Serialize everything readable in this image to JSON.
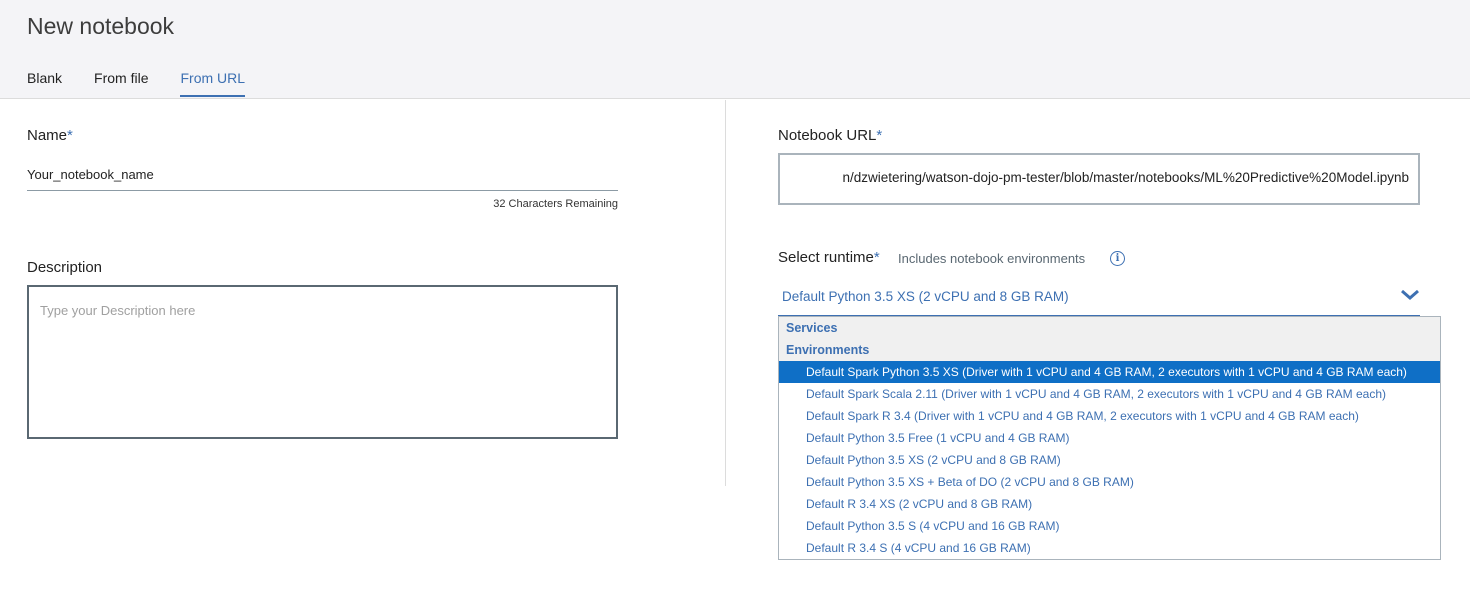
{
  "header": {
    "title": "New notebook",
    "tabs": [
      "Blank",
      "From file",
      "From URL"
    ],
    "active_tab": "From URL"
  },
  "form": {
    "name_label": "Name",
    "required_mark": "*",
    "name_value": "Your_notebook_name",
    "chars_remaining": "32 Characters Remaining",
    "description_label": "Description",
    "description_placeholder": "Type your Description here",
    "url_label": "Notebook URL",
    "url_value": "n/dzwietering/watson-dojo-pm-tester/blob/master/notebooks/ML%20Predictive%20Model.ipynb",
    "runtime_label": "Select runtime",
    "runtime_note": "Includes notebook environments",
    "runtime_selected": "Default Python 3.5 XS (2 vCPU and 8 GB RAM)"
  },
  "dropdown": {
    "groups": [
      "Services",
      "Environments"
    ],
    "options": [
      "Default Spark Python 3.5 XS (Driver with 1 vCPU and 4 GB RAM, 2 executors with 1 vCPU and 4 GB RAM each)",
      "Default Spark Scala 2.11 (Driver with 1 vCPU and 4 GB RAM, 2 executors with 1 vCPU and 4 GB RAM each)",
      "Default Spark R 3.4 (Driver with 1 vCPU and 4 GB RAM, 2 executors with 1 vCPU and 4 GB RAM each)",
      "Default Python 3.5 Free (1 vCPU and 4 GB RAM)",
      "Default Python 3.5 XS (2 vCPU and 8 GB RAM)",
      "Default Python 3.5 XS + Beta of DO (2 vCPU and 8 GB RAM)",
      "Default R 3.4 XS (2 vCPU and 8 GB RAM)",
      "Default Python 3.5 S (4 vCPU and 16 GB RAM)",
      "Default R 3.4 S (4 vCPU and 16 GB RAM)"
    ],
    "highlighted_option": "Default Spark Python 3.5 XS (Driver with 1 vCPU and 4 GB RAM, 2 executors with 1 vCPU and 4 GB RAM each)"
  },
  "icons": {
    "info": "info-icon",
    "chevron": "chevron-down-icon"
  },
  "colors": {
    "accent": "#3d70b2",
    "highlight": "#0f6fc6"
  }
}
